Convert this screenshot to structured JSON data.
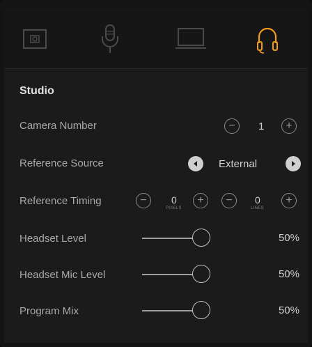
{
  "tabs": [
    {
      "icon": "camera-icon",
      "active": false
    },
    {
      "icon": "microphone-icon",
      "active": false
    },
    {
      "icon": "monitor-icon",
      "active": false
    },
    {
      "icon": "headphones-icon",
      "active": true
    }
  ],
  "colors": {
    "accent": "#f29a1a",
    "inactive_icon": "#4a4a4a"
  },
  "section_title": "Studio",
  "camera_number": {
    "label": "Camera Number",
    "value": "1"
  },
  "reference_source": {
    "label": "Reference Source",
    "value": "External"
  },
  "reference_timing": {
    "label": "Reference Timing",
    "pixels_value": "0",
    "pixels_caption": "PIXELS",
    "lines_value": "0",
    "lines_caption": "LINES"
  },
  "sliders": [
    {
      "label": "Headset Level",
      "value_text": "50%",
      "value": 50
    },
    {
      "label": "Headset Mic Level",
      "value_text": "50%",
      "value": 50
    },
    {
      "label": "Program Mix",
      "value_text": "50%",
      "value": 50
    }
  ]
}
